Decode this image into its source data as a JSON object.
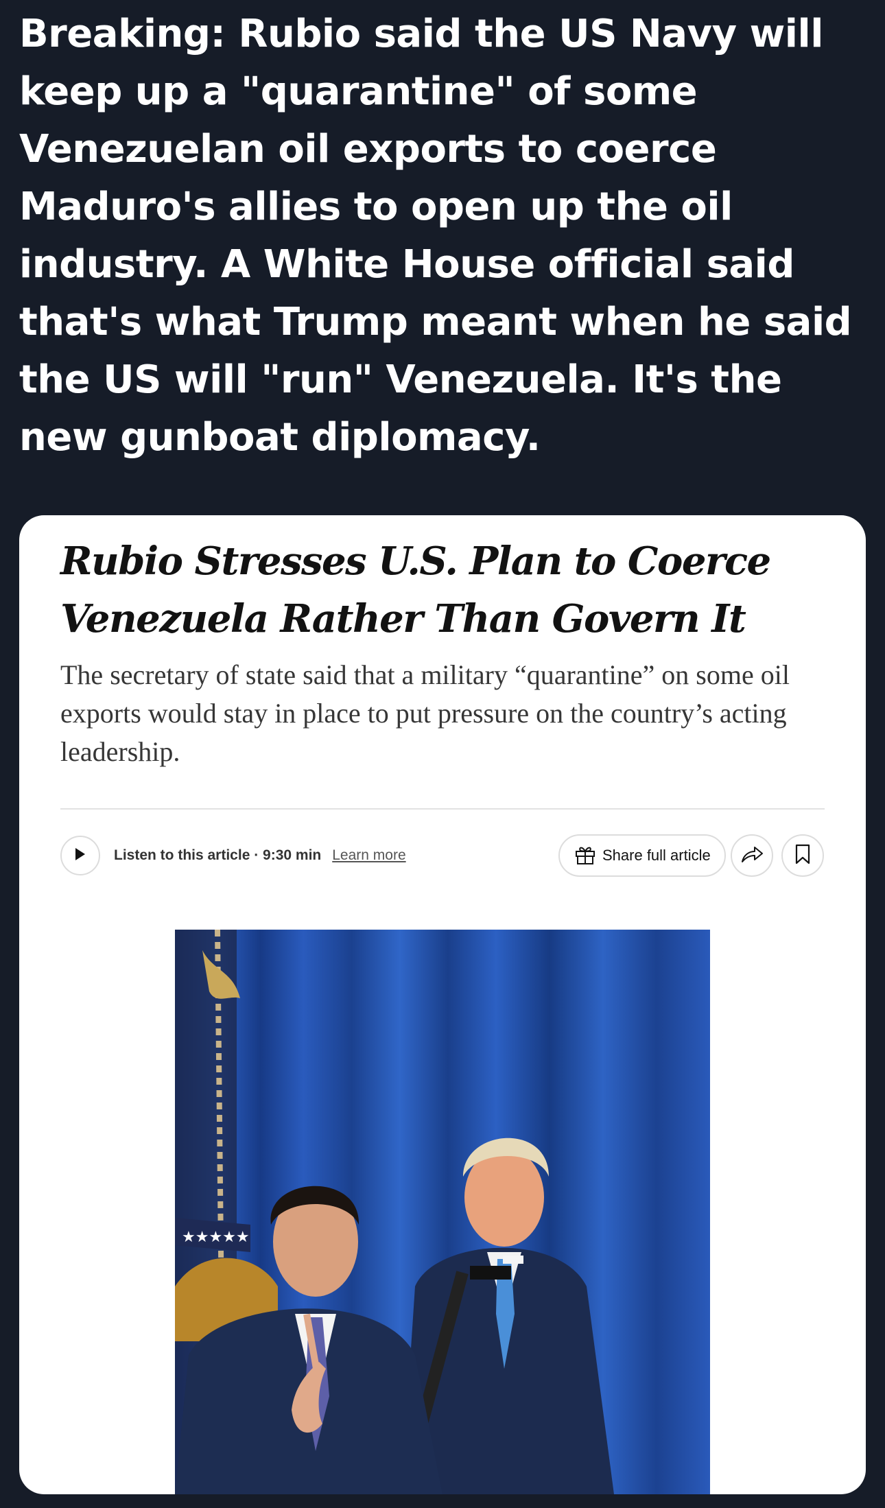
{
  "post": {
    "text": "Breaking: Rubio said the US Navy will keep up a \"quarantine\" of some Venezuelan oil exports to coerce Maduro's allies to open up the oil industry. A White House official said that's what Trump meant when he said the US will \"run\" Venezuela. It's the new gunboat diplomacy."
  },
  "article": {
    "headline": "Rubio Stresses U.S. Plan to Coerce Venezuela Rather Than Govern It",
    "summary": "The secretary of state said that a military “quarantine” on some oil exports would stay in place to put pressure on the country’s acting leadership.",
    "audio": {
      "listen_label": "Listen to this article · 9:30 min",
      "learn_more": "Learn more"
    },
    "share_label": "Share full article",
    "icons": {
      "play": "play-icon",
      "gift": "gift-icon",
      "share": "share-arrow-icon",
      "bookmark": "bookmark-icon"
    }
  },
  "colors": {
    "page_background": "#161c28",
    "card_background": "#ffffff",
    "curtain_blue": "#1f4fa8",
    "suit_navy": "#1e2f55",
    "tie_light_blue": "#4a8fd8"
  }
}
